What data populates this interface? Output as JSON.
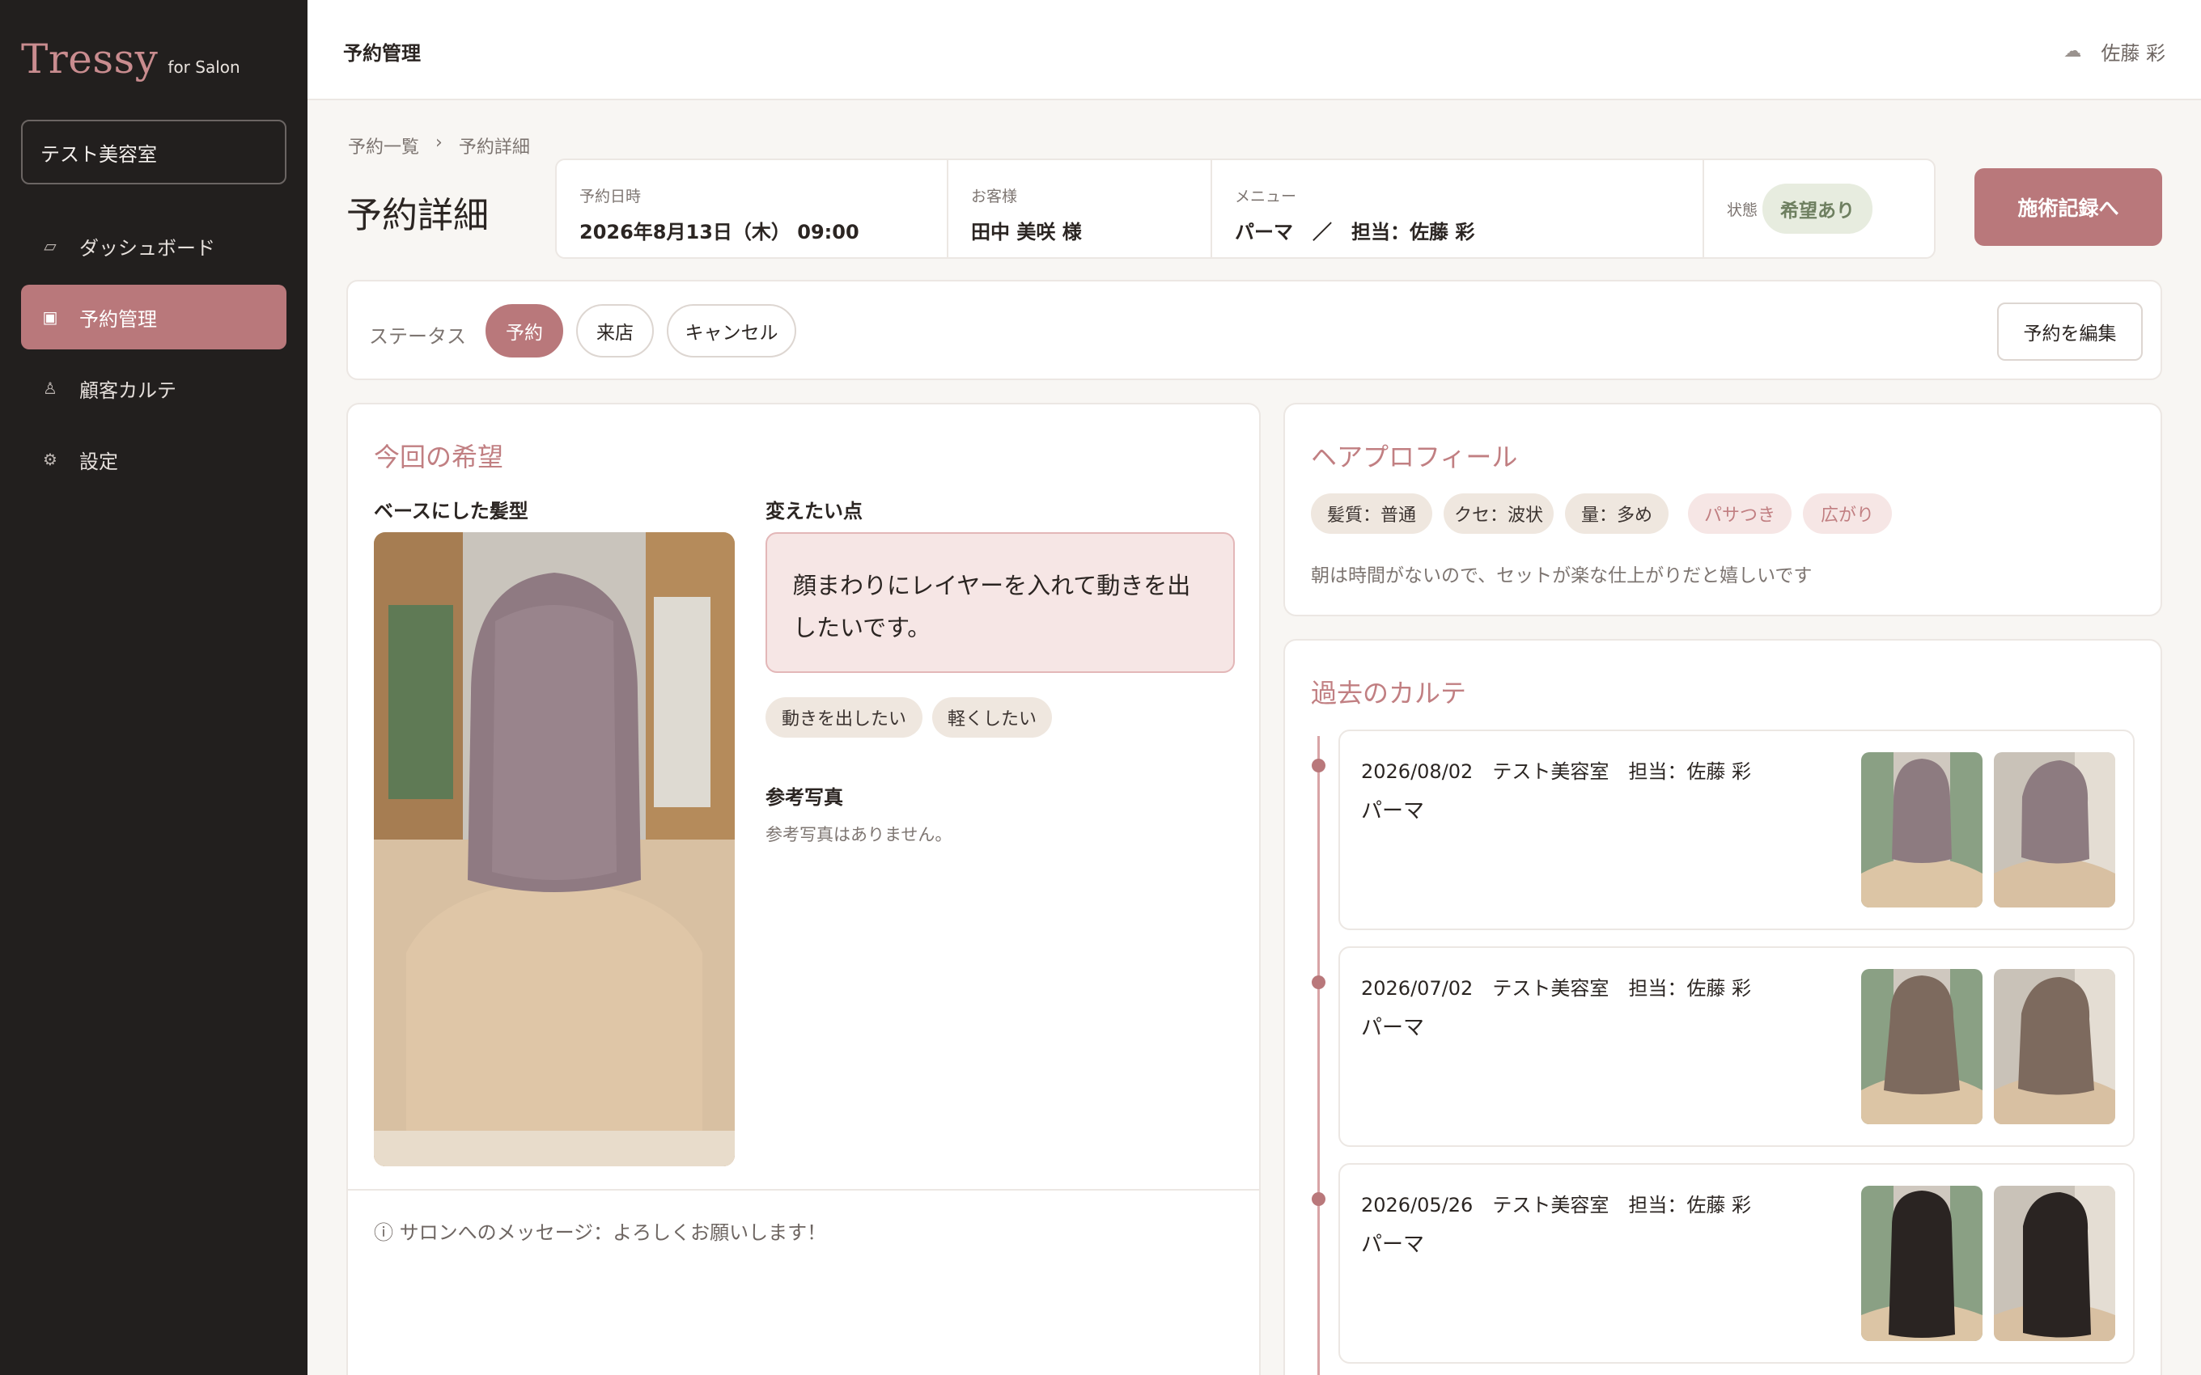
{
  "app": {
    "logo": "Tressy",
    "logo_sub": "for Salon",
    "salon_name": "テスト美容室"
  },
  "nav": [
    {
      "label": "ダッシュボード",
      "icon": "tablet-icon",
      "active": false
    },
    {
      "label": "予約管理",
      "icon": "calendar-icon",
      "active": true
    },
    {
      "label": "顧客カルテ",
      "icon": "person-icon",
      "active": false
    },
    {
      "label": "設定",
      "icon": "gear-icon",
      "active": false
    }
  ],
  "topbar": {
    "title": "予約管理",
    "user_name": "佐藤 彩",
    "user_icon": "cloud-icon"
  },
  "breadcrumb": [
    "予約一覧",
    "›",
    "予約詳細"
  ],
  "page_title": "予約詳細",
  "reservation": {
    "datetime_label": "予約日時",
    "datetime": "2026年8月13日（木） 09:00",
    "customer_label": "お客様",
    "customer": "田中 美咲 様",
    "menu_label": "メニュー",
    "menu": "パーマ　／　担当：佐藤 彩",
    "state_label": "状態",
    "state": "希望あり"
  },
  "record_button": "施術記録へ",
  "status": {
    "label": "ステータス",
    "options": [
      "予約",
      "来店",
      "キャンセル"
    ],
    "selected": "予約",
    "edit_button": "予約を編集"
  },
  "wish": {
    "title": "今回の希望",
    "base_style_heading": "ベースにした髪型",
    "change_heading": "変えたい点",
    "change_text": "顔まわりにレイヤーを入れて動きを出したいです。",
    "tags": [
      "動きを出したい",
      "軽くしたい"
    ],
    "reference_heading": "参考写真",
    "reference_empty": "参考写真はありません。",
    "message": "ⓘ サロンへのメッセージ：よろしくお願いします！"
  },
  "hair_profile": {
    "title": "ヘアプロフィール",
    "tags": [
      {
        "label": "髪質：普通",
        "highlight": false
      },
      {
        "label": "クセ：波状",
        "highlight": false
      },
      {
        "label": "量：多め",
        "highlight": false
      },
      {
        "label": "パサつき",
        "highlight": true
      },
      {
        "label": "広がり",
        "highlight": true
      }
    ],
    "note": "朝は時間がないので、セットが楽な仕上がりだと嬉しいです"
  },
  "history": {
    "title": "過去のカルテ",
    "entries": [
      {
        "date": "2026/08/02",
        "salon": "テスト美容室",
        "staff": "担当：佐藤 彩",
        "menu": "パーマ",
        "hair": "#8d7b80"
      },
      {
        "date": "2026/07/02",
        "salon": "テスト美容室",
        "staff": "担当：佐藤 彩",
        "menu": "パーマ",
        "hair": "#7d6a5e"
      },
      {
        "date": "2026/05/26",
        "salon": "テスト美容室",
        "staff": "担当：佐藤 彩",
        "menu": "パーマ",
        "hair": "#2a2422"
      }
    ]
  },
  "colors": {
    "accent": "#b9787b",
    "title_accent": "#c17f82",
    "sidebar_bg": "#221f1e",
    "badge_green": "#6e7f60"
  }
}
